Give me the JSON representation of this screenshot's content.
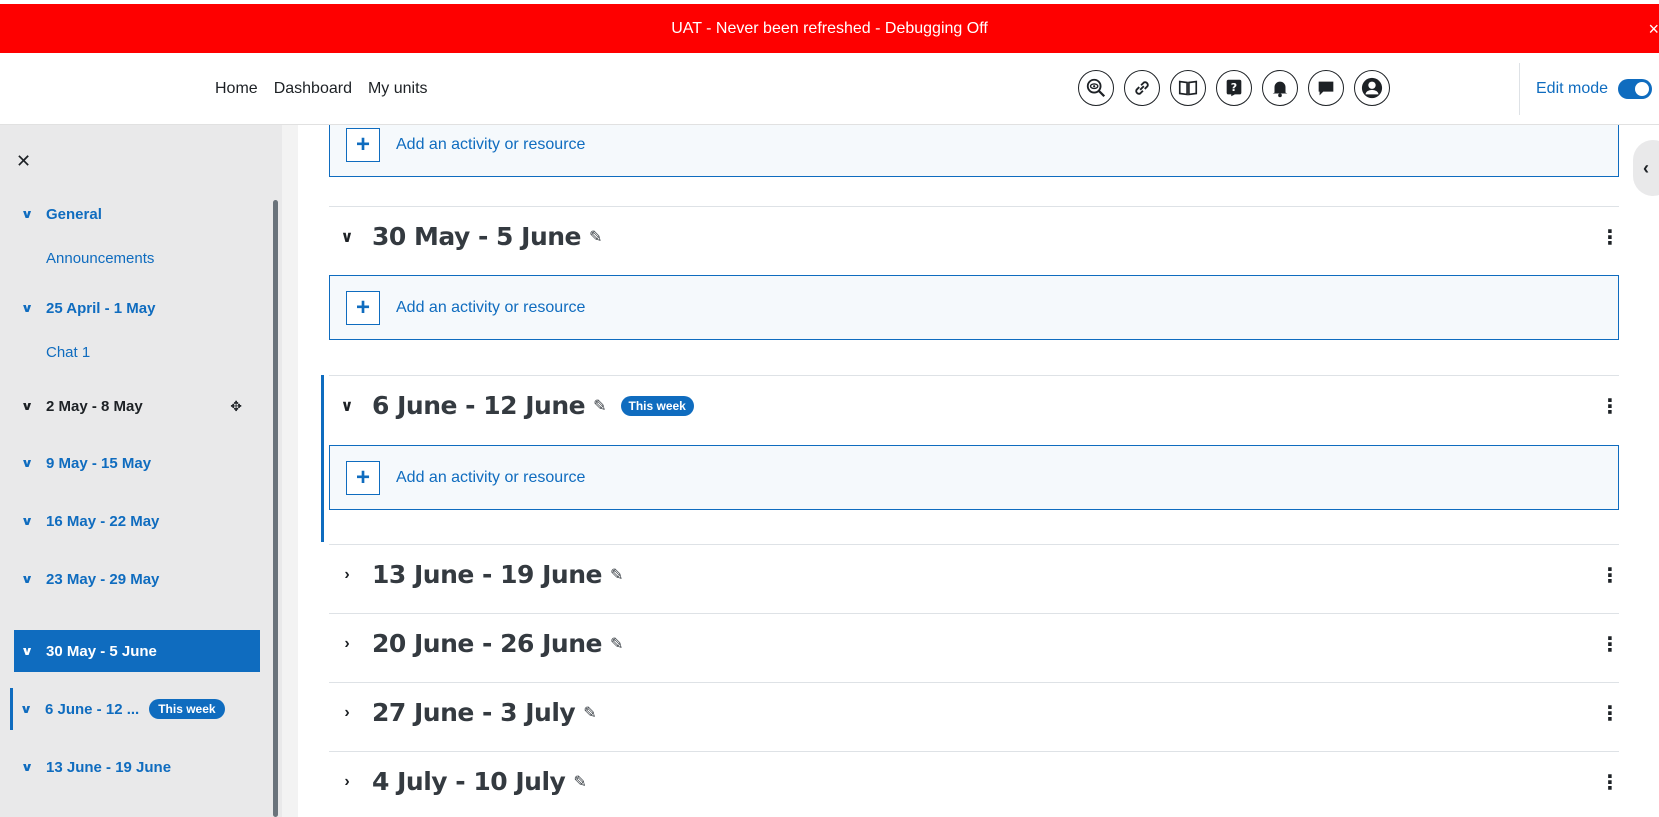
{
  "banner": {
    "text": "UAT - Never been refreshed - Debugging Off",
    "close": "×",
    "color": "#fe0000"
  },
  "nav": {
    "links": [
      "Home",
      "Dashboard",
      "My units"
    ],
    "icons": [
      "accessibility-icon",
      "link-icon",
      "book-icon",
      "help-icon",
      "bell-icon",
      "chat-icon",
      "user-avatar-icon"
    ],
    "edit_mode_label": "Edit mode",
    "edit_mode_on": true
  },
  "drawer": {
    "close": "✕",
    "items": [
      {
        "label": "General",
        "type": "section"
      },
      {
        "label": "Announcements",
        "type": "activity"
      },
      {
        "label": "25 April - 1 May",
        "type": "section"
      },
      {
        "label": "Chat 1",
        "type": "activity"
      },
      {
        "label": "2 May - 8 May",
        "type": "section",
        "state": "current"
      },
      {
        "label": "9 May - 15 May",
        "type": "section"
      },
      {
        "label": "16 May - 22 May",
        "type": "section"
      },
      {
        "label": "23 May - 29 May",
        "type": "section"
      },
      {
        "label": "30 May - 5 June",
        "type": "section",
        "state": "active"
      },
      {
        "label": "6 June - 12 ...",
        "type": "section",
        "badge": "This week"
      },
      {
        "label": "13 June - 19 June",
        "type": "section"
      }
    ]
  },
  "main": {
    "add_label": "Add an activity or resource",
    "plus": "+",
    "sections": [
      {
        "title": "30 May - 5 June",
        "expanded": true
      },
      {
        "title": "6 June - 12 June",
        "expanded": true,
        "badge": "This week"
      },
      {
        "title": "13 June - 19 June",
        "expanded": false
      },
      {
        "title": "20 June - 26 June",
        "expanded": false
      },
      {
        "title": "27 June - 3 July",
        "expanded": false
      },
      {
        "title": "4 July - 10 July",
        "expanded": false
      }
    ]
  },
  "colors": {
    "primary": "#0f6cbf",
    "drawer_bg": "#e9e9ea"
  }
}
